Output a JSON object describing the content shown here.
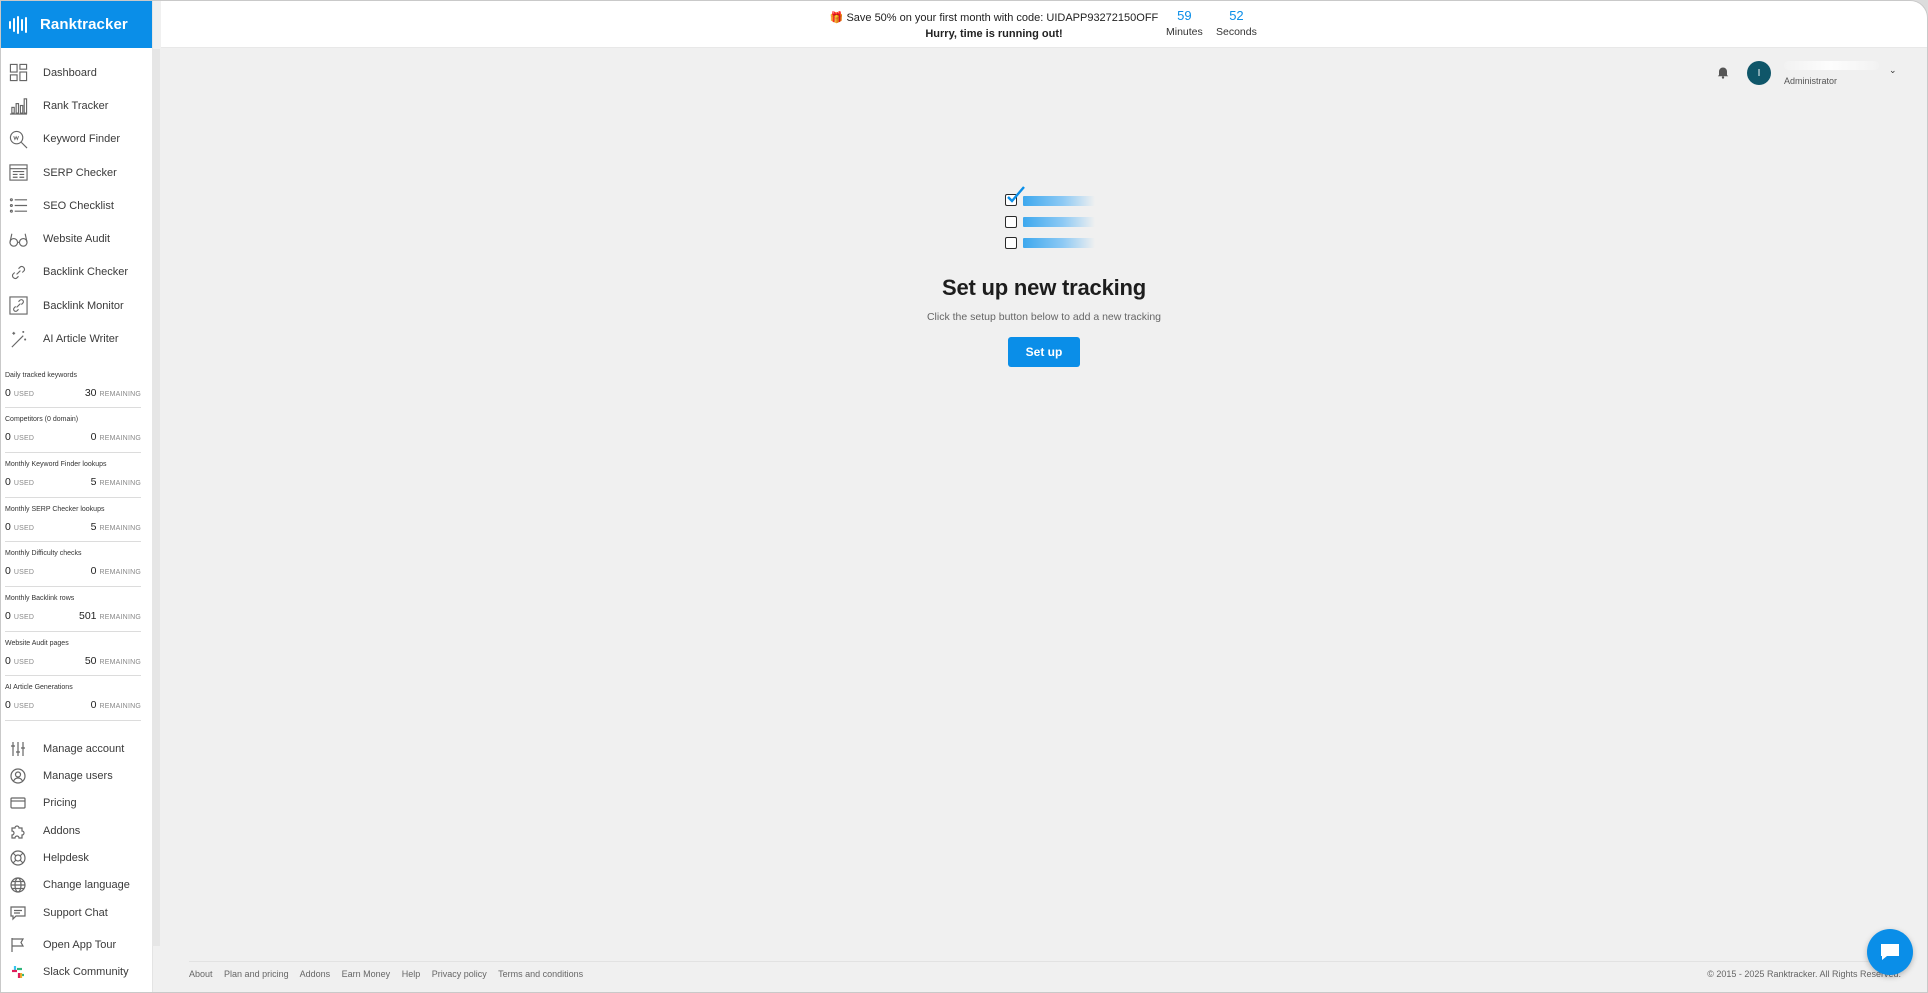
{
  "brand": {
    "name": "Ranktracker"
  },
  "promo": {
    "line1": "Save 50% on your first month with code: UIDAPP93272150OFF",
    "line2": "Hurry, time is running out!",
    "minutes_value": "59",
    "minutes_label": "Minutes",
    "seconds_value": "52",
    "seconds_label": "Seconds"
  },
  "sidebar": {
    "nav": [
      {
        "label": "Dashboard",
        "icon": "dashboard-icon"
      },
      {
        "label": "Rank Tracker",
        "icon": "bar-chart-icon"
      },
      {
        "label": "Keyword Finder",
        "icon": "magnifier-icon"
      },
      {
        "label": "SERP Checker",
        "icon": "serp-icon"
      },
      {
        "label": "SEO Checklist",
        "icon": "checklist-icon"
      },
      {
        "label": "Website Audit",
        "icon": "glasses-icon"
      },
      {
        "label": "Backlink Checker",
        "icon": "link-icon"
      },
      {
        "label": "Backlink Monitor",
        "icon": "monitor-link-icon"
      },
      {
        "label": "AI Article Writer",
        "icon": "magic-wand-icon"
      }
    ],
    "quotas": [
      {
        "title": "Daily tracked keywords",
        "used": "0",
        "used_label": "USED",
        "remaining": "30",
        "remaining_label": "REMAINING"
      },
      {
        "title": "Competitors (0 domain)",
        "used": "0",
        "used_label": "USED",
        "remaining": "0",
        "remaining_label": "REMAINING"
      },
      {
        "title": "Monthly Keyword Finder lookups",
        "used": "0",
        "used_label": "USED",
        "remaining": "5",
        "remaining_label": "REMAINING"
      },
      {
        "title": "Monthly SERP Checker lookups",
        "used": "0",
        "used_label": "USED",
        "remaining": "5",
        "remaining_label": "REMAINING"
      },
      {
        "title": "Monthly Difficulty checks",
        "used": "0",
        "used_label": "USED",
        "remaining": "0",
        "remaining_label": "REMAINING"
      },
      {
        "title": "Monthly Backlink rows",
        "used": "0",
        "used_label": "USED",
        "remaining": "501",
        "remaining_label": "REMAINING"
      },
      {
        "title": "Website Audit pages",
        "used": "0",
        "used_label": "USED",
        "remaining": "50",
        "remaining_label": "REMAINING"
      },
      {
        "title": "AI Article Generations",
        "used": "0",
        "used_label": "USED",
        "remaining": "0",
        "remaining_label": "REMAINING"
      }
    ],
    "bottom": [
      {
        "label": "Manage account",
        "icon": "sliders-icon"
      },
      {
        "label": "Manage users",
        "icon": "user-circle-icon"
      },
      {
        "label": "Pricing",
        "icon": "credit-card-icon"
      },
      {
        "label": "Addons",
        "icon": "puzzle-icon"
      },
      {
        "label": "Helpdesk",
        "icon": "lifebuoy-icon"
      },
      {
        "label": "Change language",
        "icon": "globe-icon"
      },
      {
        "label": "Support Chat",
        "icon": "chat-icon"
      },
      {
        "label": "Open App Tour",
        "icon": "flag-icon"
      },
      {
        "label": "Slack Community",
        "icon": "slack-icon"
      }
    ]
  },
  "user": {
    "initial": "I",
    "role": "Administrator"
  },
  "empty_state": {
    "title": "Set up new tracking",
    "subtitle": "Click the setup button below to add a new tracking",
    "button": "Set up"
  },
  "footer": {
    "links": [
      "About",
      "Plan and pricing",
      "Addons",
      "Earn Money",
      "Help",
      "Privacy policy",
      "Terms and conditions"
    ],
    "copyright": "© 2015 - 2025 Ranktracker. All Rights Reserved."
  },
  "colors": {
    "accent": "#0a8ee8",
    "avatar": "#0f5669"
  }
}
